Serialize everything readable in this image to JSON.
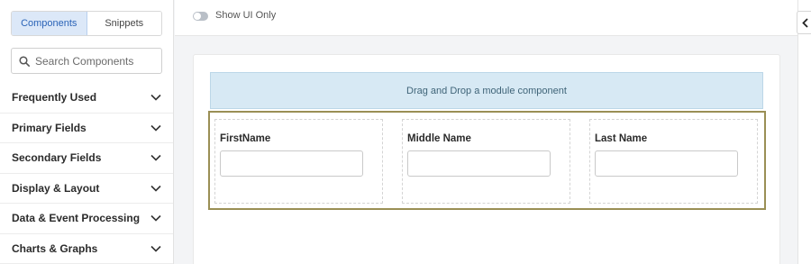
{
  "sidebar": {
    "tabs": [
      {
        "label": "Components",
        "active": true
      },
      {
        "label": "Snippets",
        "active": false
      }
    ],
    "search": {
      "placeholder": "Search Components",
      "icon": "search-icon"
    },
    "categories": [
      {
        "label": "Frequently Used",
        "icon": "chevron-down-icon"
      },
      {
        "label": "Primary Fields",
        "icon": "chevron-down-icon"
      },
      {
        "label": "Secondary Fields",
        "icon": "chevron-down-icon"
      },
      {
        "label": "Display & Layout",
        "icon": "chevron-down-icon"
      },
      {
        "label": "Data & Event Processing",
        "icon": "chevron-down-icon"
      },
      {
        "label": "Charts & Graphs",
        "icon": "chevron-down-icon"
      }
    ]
  },
  "topbar": {
    "toggle_label": "Show UI Only",
    "toggle_on": false
  },
  "canvas": {
    "dropzone_text": "Drag and Drop a module component",
    "fields": [
      {
        "label": "FirstName",
        "value": ""
      },
      {
        "label": "Middle Name",
        "value": ""
      },
      {
        "label": "Last Name",
        "value": ""
      }
    ]
  },
  "panel": {
    "collapse_icon": "chevron-left-icon"
  },
  "colors": {
    "accent": "#2a63b7",
    "active_tab_bg": "#dce8f8",
    "dropzone_bg": "#d7e9f4",
    "row_border": "#9a8f55"
  }
}
